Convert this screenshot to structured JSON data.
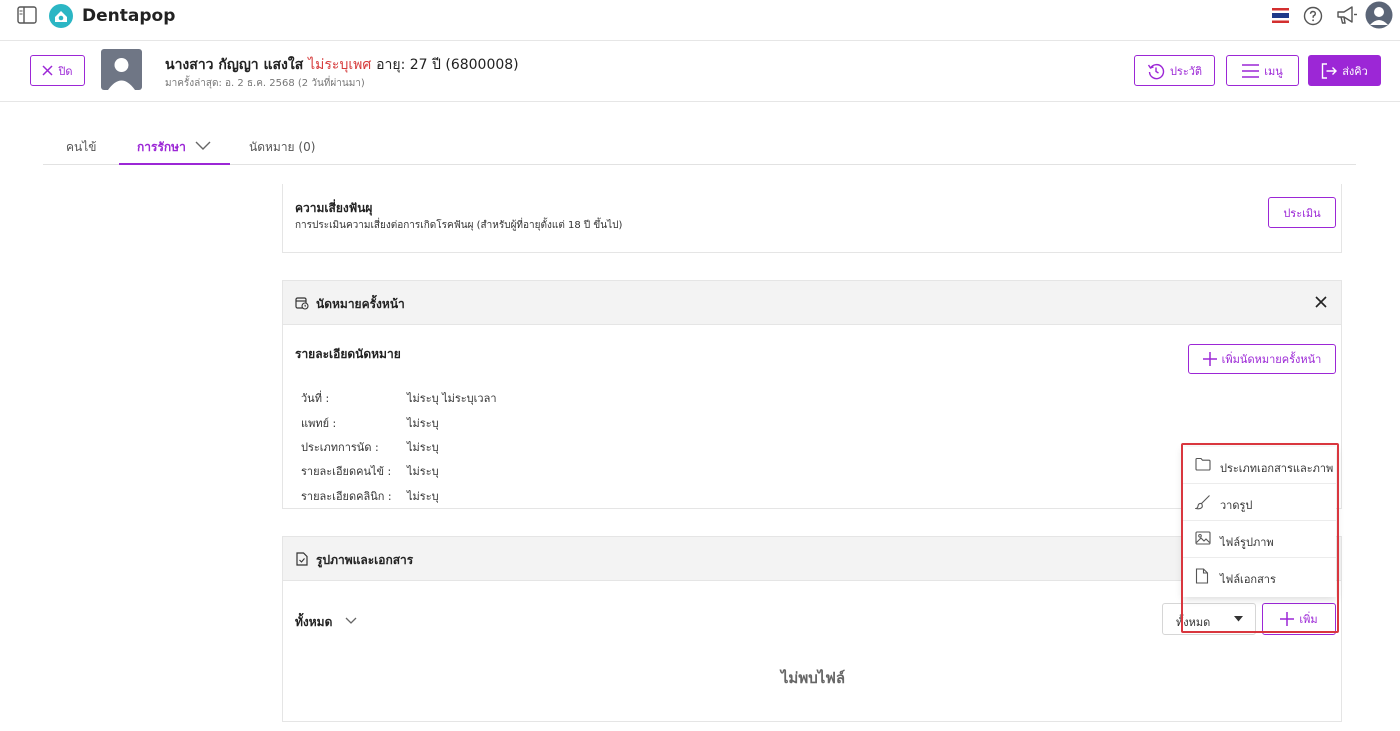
{
  "app": {
    "name": "Dentapop"
  },
  "patient": {
    "name": "นางสาว กัญญา แสงใส",
    "gender": "ไม่ระบุเพศ",
    "age_id": "อายุ: 27 ปี  (6800008)",
    "last_visit": "มาครั้งล่าสุด: อ. 2 ธ.ค. 2568 (2 วันที่ผ่านมา)"
  },
  "header_buttons": {
    "close": "ปิด",
    "history": "ประวัติ",
    "menu": "เมนู",
    "send": "ส่งคิว"
  },
  "tabs": [
    {
      "label": "คนไข้"
    },
    {
      "label": "การรักษา"
    },
    {
      "label": "นัดหมาย (0)"
    }
  ],
  "risk": {
    "title": "ความเสี่ยงฟันผุ",
    "subtitle": "การประเมินความเสี่ยงต่อการเกิดโรคฟันผุ (สำหรับผู้ที่อายุตั้งแต่ 18 ปี ขึ้นไป)",
    "button": "ประเมิน"
  },
  "appointment": {
    "header": "นัดหมายครั้งหน้า",
    "section_title": "รายละเอียดนัดหมาย",
    "add_button": "เพิ่มนัดหมายครั้งหน้า",
    "rows": [
      {
        "label": "วันที่ :",
        "value": "ไม่ระบุ  ไม่ระบุเวลา"
      },
      {
        "label": "แพทย์ :",
        "value": "ไม่ระบุ"
      },
      {
        "label": "ประเภทการนัด :",
        "value": "ไม่ระบุ"
      },
      {
        "label": "รายละเอียดคนไข้ :",
        "value": "ไม่ระบุ"
      },
      {
        "label": "รายละเอียดคลินิก :",
        "value": "ไม่ระบุ"
      }
    ]
  },
  "documents": {
    "header": "รูปภาพและเอกสาร",
    "filter_label": "ทั้งหมด",
    "select_value": "ทั้งหมด",
    "add_button": "เพิ่ม",
    "empty_text": "ไม่พบไฟล์"
  },
  "add_menu": {
    "items": [
      {
        "label": "ประเภทเอกสารและภาพ",
        "icon": "folder-icon"
      },
      {
        "label": "วาดรูป",
        "icon": "brush-icon"
      },
      {
        "label": "ไฟล์รูปภาพ",
        "icon": "image-icon"
      },
      {
        "label": "ไฟล์เอกสาร",
        "icon": "file-icon"
      }
    ]
  },
  "colors": {
    "accent": "#9c27d6",
    "gender_red": "#d63b3b",
    "highlight_border": "#d9363e"
  }
}
